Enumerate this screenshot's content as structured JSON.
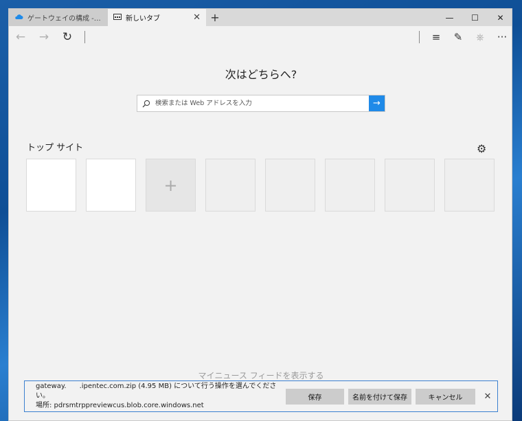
{
  "tabs": [
    {
      "label": "ゲートウェイの構成 - Microsoft",
      "icon": "cloud-icon",
      "active": false
    },
    {
      "label": "新しいタブ",
      "icon": "newtab-page-icon",
      "active": true
    }
  ],
  "tabbar": {
    "close_glyph": "✕",
    "new_tab_glyph": "+"
  },
  "window_controls": {
    "minimize": "—",
    "maximize": "☐",
    "close": "✕"
  },
  "toolbar": {
    "back": "←",
    "forward": "→",
    "refresh": "↻",
    "hub": "≡",
    "note": "✎",
    "share": "⎈",
    "more": "···"
  },
  "heading": "次はどちらへ?",
  "search": {
    "placeholder": "検索または Web アドレスを入力",
    "go": "→",
    "icon": "search-icon"
  },
  "top_sites": {
    "title": "トップ サイト",
    "settings_glyph": "⚙",
    "add_glyph": "+"
  },
  "feed_link": "マイニュース フィードを表示する",
  "download": {
    "line1": "gateway.      .ipentec.com.zip (4.95 MB) について行う操作を選んでください。",
    "line2": "場所: pdrsmtrppreviewcus.blob.core.windows.net",
    "save": "保存",
    "save_as": "名前を付けて保存",
    "cancel": "キャンセル",
    "close": "✕"
  },
  "colors": {
    "accent": "#1f8ae8",
    "download_border": "#3a7fd0"
  }
}
